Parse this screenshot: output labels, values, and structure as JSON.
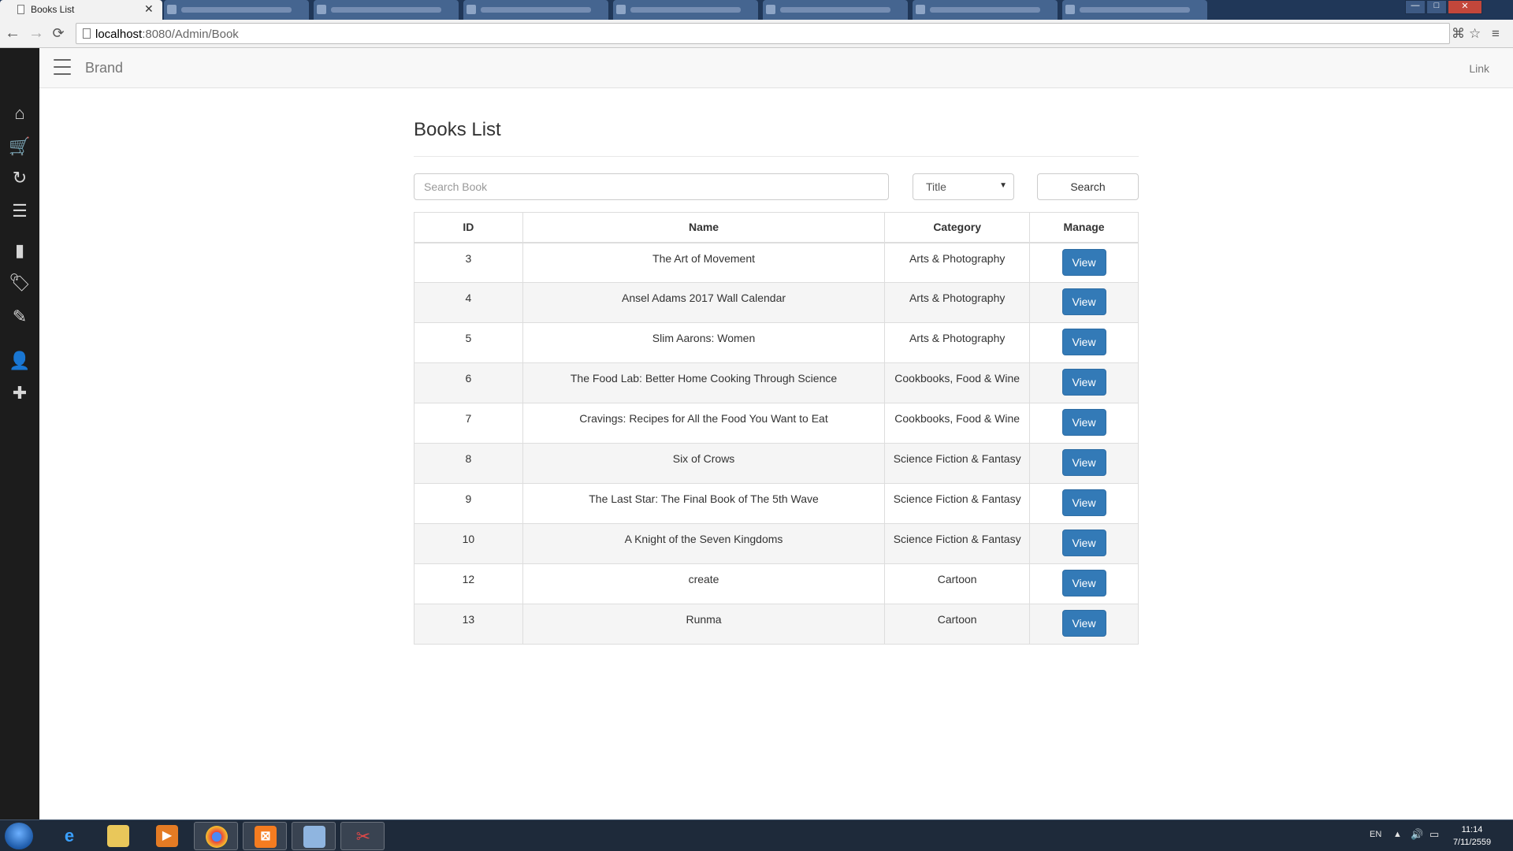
{
  "browser": {
    "active_tab": {
      "title": "Books List",
      "close": "✕"
    },
    "inactive_tab_count": 7,
    "url_host": "localhost",
    "url_rest": ":8080/Admin/Book",
    "nav": {
      "back": "←",
      "forward": "→",
      "reload": "⟳"
    }
  },
  "sidebar": {
    "items": [
      {
        "name": "home-icon",
        "glyph": "⌂"
      },
      {
        "name": "cart-icon",
        "glyph": "🛒"
      },
      {
        "name": "refresh-icon",
        "glyph": "↻"
      },
      {
        "name": "list-icon",
        "glyph": "☰"
      },
      {
        "name": "book-icon",
        "glyph": "▮"
      },
      {
        "name": "tags-icon",
        "glyph": "🏷"
      },
      {
        "name": "pencil-icon",
        "glyph": "✎"
      },
      {
        "name": "user-icon",
        "glyph": "👤"
      },
      {
        "name": "plus-icon",
        "glyph": "✚"
      }
    ]
  },
  "navbar": {
    "brand": "Brand",
    "link": "Link"
  },
  "page": {
    "title": "Books List",
    "search_placeholder": "Search Book",
    "filter_selected": "Title",
    "search_button": "Search"
  },
  "table": {
    "headers": {
      "id": "ID",
      "name": "Name",
      "category": "Category",
      "manage": "Manage"
    },
    "rows": [
      {
        "id": "3",
        "name": "The Art of Movement",
        "category": "Arts & Photography",
        "action": "View"
      },
      {
        "id": "4",
        "name": "Ansel Adams 2017 Wall Calendar",
        "category": "Arts & Photography",
        "action": "View"
      },
      {
        "id": "5",
        "name": "Slim Aarons: Women",
        "category": "Arts & Photography",
        "action": "View"
      },
      {
        "id": "6",
        "name": "The Food Lab: Better Home Cooking Through Science",
        "category": "Cookbooks, Food & Wine",
        "action": "View"
      },
      {
        "id": "7",
        "name": "Cravings: Recipes for All the Food You Want to Eat",
        "category": "Cookbooks, Food & Wine",
        "action": "View"
      },
      {
        "id": "8",
        "name": "Six of Crows",
        "category": "Science Fiction & Fantasy",
        "action": "View"
      },
      {
        "id": "9",
        "name": "The Last Star: The Final Book of The 5th Wave",
        "category": "Science Fiction & Fantasy",
        "action": "View"
      },
      {
        "id": "10",
        "name": "A Knight of the Seven Kingdoms",
        "category": "Science Fiction & Fantasy",
        "action": "View"
      },
      {
        "id": "12",
        "name": "create",
        "category": "Cartoon",
        "action": "View"
      },
      {
        "id": "13",
        "name": "Runma",
        "category": "Cartoon",
        "action": "View"
      }
    ]
  },
  "taskbar": {
    "lang": "EN",
    "time": "11:14",
    "date": "7/11/2559"
  },
  "colors": {
    "primary_button": "#337ab7",
    "sidebar_bg": "#1c1c1c",
    "tab_strip": "#203758"
  }
}
